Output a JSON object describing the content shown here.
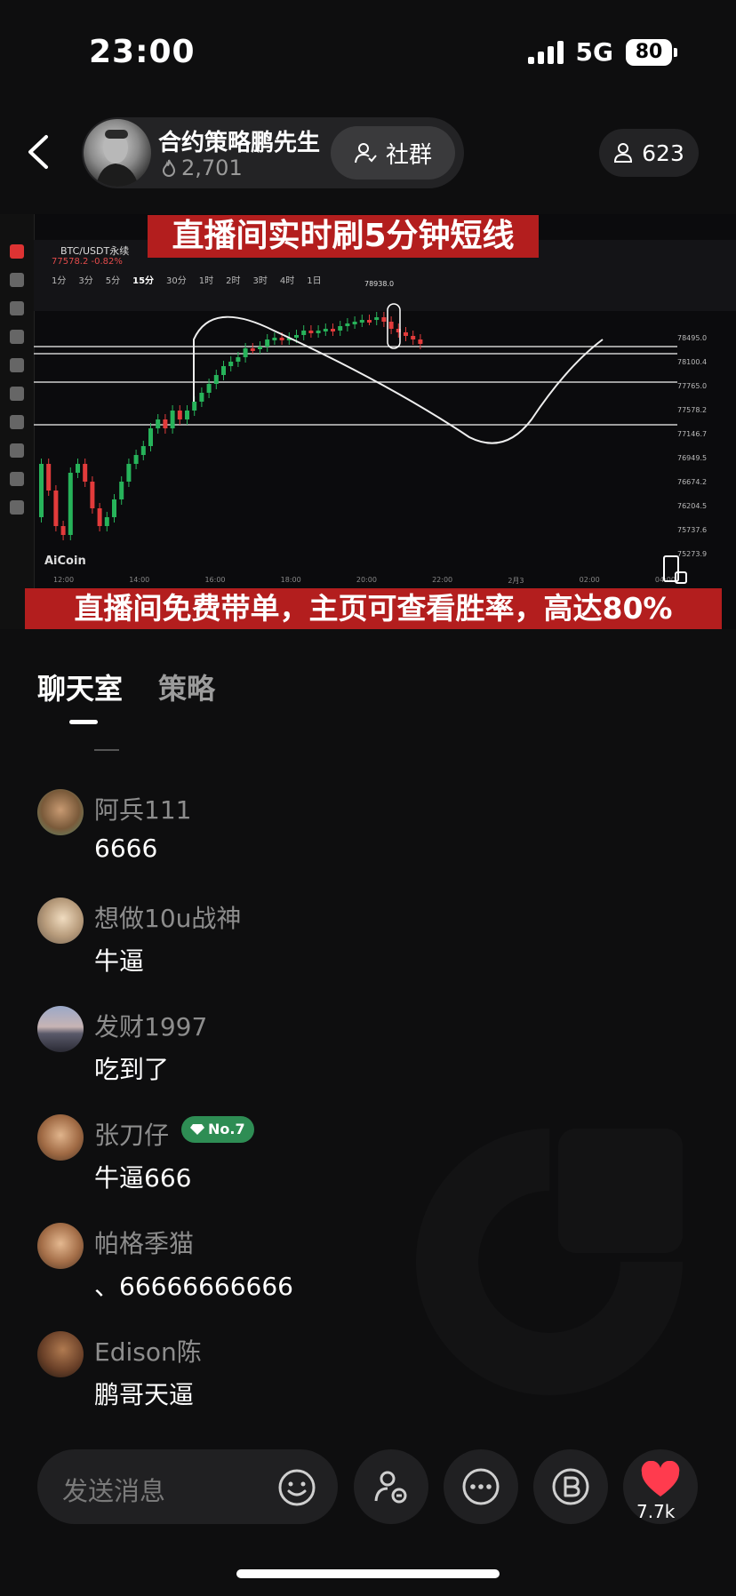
{
  "status_bar": {
    "time": "23:00",
    "network": "5G",
    "battery": "80"
  },
  "header": {
    "host_name": "合约策略鹏先生",
    "host_likes": "2,701",
    "community_label": "社群",
    "viewer_count": "623"
  },
  "video": {
    "banner_top": "直播间实时刷5分钟短线",
    "banner_bottom": "直播间免费带单，主页可查看胜率，高达80%",
    "pair": "BTC/USDT永续",
    "pair_price": "77578.2 -0.82%",
    "timeframes": [
      "1分",
      "3分",
      "5分",
      "15分",
      "30分",
      "1时",
      "2时",
      "3时",
      "4时",
      "1日"
    ],
    "active_timeframe": "15分",
    "brand": "AiCoin",
    "x_labels": [
      "12:00",
      "14:00",
      "16:00",
      "18:00",
      "20:00",
      "22:00",
      "2月3",
      "02:00",
      "04:00"
    ],
    "price_labels": [
      "78495.0",
      "78100.4",
      "77765.0",
      "77578.2",
      "77146.7",
      "76949.5",
      "76674.2",
      "76204.5",
      "75737.6",
      "75273.9"
    ],
    "peak_label": "78938.0"
  },
  "tabs": {
    "chat": "聊天室",
    "strategy": "策略"
  },
  "messages": [
    {
      "user": "阿兵111",
      "text": "6666"
    },
    {
      "user": "想做10u战神",
      "text": "牛逼"
    },
    {
      "user": "发财1997",
      "text": "吃到了"
    },
    {
      "user": "张刀仔",
      "badge": "No.7",
      "text": "牛逼666"
    },
    {
      "user": "帕格季猫",
      "text": "、66666666666"
    },
    {
      "user": "Edison陈",
      "text": "鹏哥天逼"
    }
  ],
  "bottom_bar": {
    "placeholder": "发送消息",
    "like_count": "7.7k"
  },
  "colors": {
    "background": "#0e0e0f",
    "banner_red": "#b31e1e",
    "badge_green": "#2e8d54",
    "like_red": "#ff3b4e"
  }
}
